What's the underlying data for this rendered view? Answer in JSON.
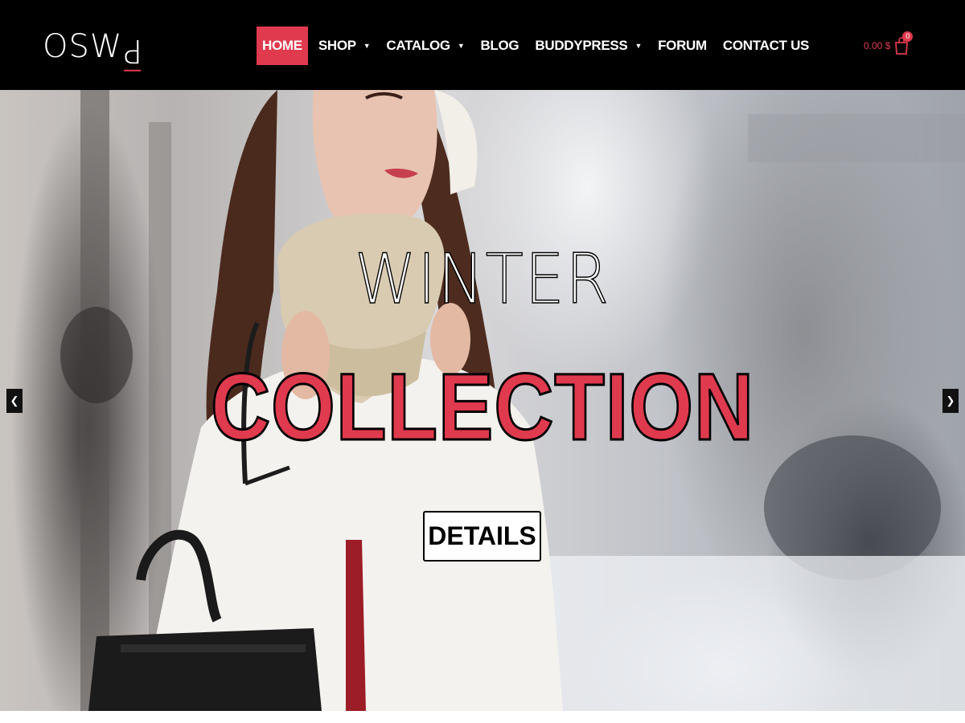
{
  "header": {
    "logo_text": "OSW",
    "logo_accent": "P",
    "nav": [
      {
        "label": "HOME",
        "active": true,
        "dropdown": false
      },
      {
        "label": "SHOP",
        "active": false,
        "dropdown": true
      },
      {
        "label": "CATALOG",
        "active": false,
        "dropdown": true
      },
      {
        "label": "BLOG",
        "active": false,
        "dropdown": false
      },
      {
        "label": "BUDDYPRESS",
        "active": false,
        "dropdown": true
      },
      {
        "label": "FORUM",
        "active": false,
        "dropdown": false
      },
      {
        "label": "CONTACT US",
        "active": false,
        "dropdown": false
      }
    ],
    "cart_total": "0.00 $",
    "cart_count": "0",
    "cart_icon": "shopping-bag-icon"
  },
  "hero": {
    "title_line_1": "WINTER",
    "title_line_2": "COLLECTION",
    "button_label": "DETAILS",
    "prev_icon": "chevron-left-icon",
    "next_icon": "chevron-right-icon"
  },
  "colors": {
    "accent": "#e03a4e",
    "header_bg": "#000000",
    "text_light": "#ffffff"
  }
}
